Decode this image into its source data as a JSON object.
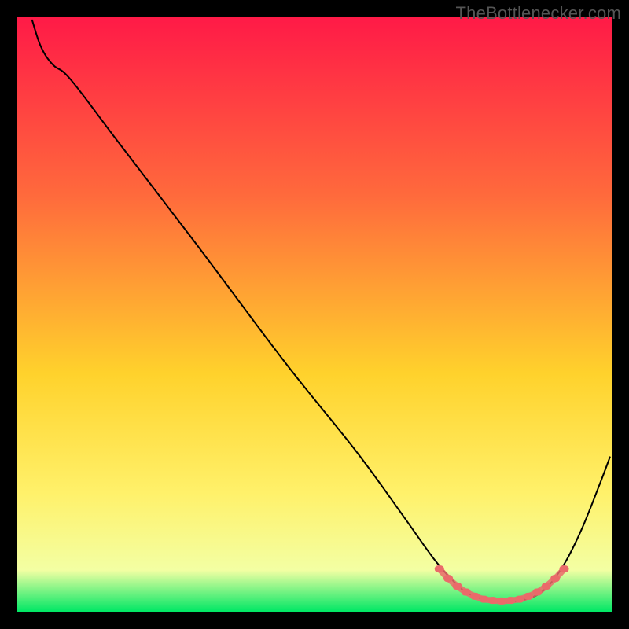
{
  "watermark": "TheBottlenecker.com",
  "chart_data": {
    "type": "line",
    "title": "",
    "xlabel": "",
    "ylabel": "",
    "xlim": [
      0,
      100
    ],
    "ylim": [
      0,
      100
    ],
    "background_gradient": {
      "top": "#ff1a47",
      "mid1": "#ff6a3c",
      "mid2": "#ffd22c",
      "mid3": "#fff16a",
      "mid4": "#f3ffa3",
      "bottom": "#00e765"
    },
    "series": [
      {
        "name": "curve",
        "stroke": "#000000",
        "stroke_width": 2,
        "points": [
          {
            "x": 2.5,
            "y": 99.5
          },
          {
            "x": 4.0,
            "y": 95.0
          },
          {
            "x": 6.0,
            "y": 92.0
          },
          {
            "x": 9.0,
            "y": 89.5
          },
          {
            "x": 17.0,
            "y": 79.0
          },
          {
            "x": 30.0,
            "y": 62.0
          },
          {
            "x": 45.0,
            "y": 42.0
          },
          {
            "x": 57.0,
            "y": 27.0
          },
          {
            "x": 65.0,
            "y": 16.0
          },
          {
            "x": 70.0,
            "y": 9.0
          },
          {
            "x": 73.5,
            "y": 5.0
          },
          {
            "x": 76.0,
            "y": 3.0
          },
          {
            "x": 79.0,
            "y": 2.0
          },
          {
            "x": 82.5,
            "y": 1.7
          },
          {
            "x": 86.0,
            "y": 2.2
          },
          {
            "x": 89.0,
            "y": 4.0
          },
          {
            "x": 92.0,
            "y": 8.0
          },
          {
            "x": 95.0,
            "y": 14.0
          },
          {
            "x": 98.0,
            "y": 21.5
          },
          {
            "x": 99.7,
            "y": 26.0
          }
        ]
      },
      {
        "name": "marker-band",
        "stroke": "#ea6a6a",
        "marker_fill": "#ea6a6a",
        "points": [
          {
            "x": 71.0,
            "y": 7.2
          },
          {
            "x": 72.5,
            "y": 5.6
          },
          {
            "x": 74.0,
            "y": 4.3
          },
          {
            "x": 75.5,
            "y": 3.3
          },
          {
            "x": 77.0,
            "y": 2.6
          },
          {
            "x": 78.5,
            "y": 2.1
          },
          {
            "x": 80.0,
            "y": 1.9
          },
          {
            "x": 81.5,
            "y": 1.8
          },
          {
            "x": 83.0,
            "y": 1.9
          },
          {
            "x": 84.5,
            "y": 2.1
          },
          {
            "x": 86.0,
            "y": 2.6
          },
          {
            "x": 87.5,
            "y": 3.3
          },
          {
            "x": 89.0,
            "y": 4.3
          },
          {
            "x": 90.5,
            "y": 5.6
          },
          {
            "x": 92.0,
            "y": 7.2
          }
        ]
      }
    ]
  }
}
